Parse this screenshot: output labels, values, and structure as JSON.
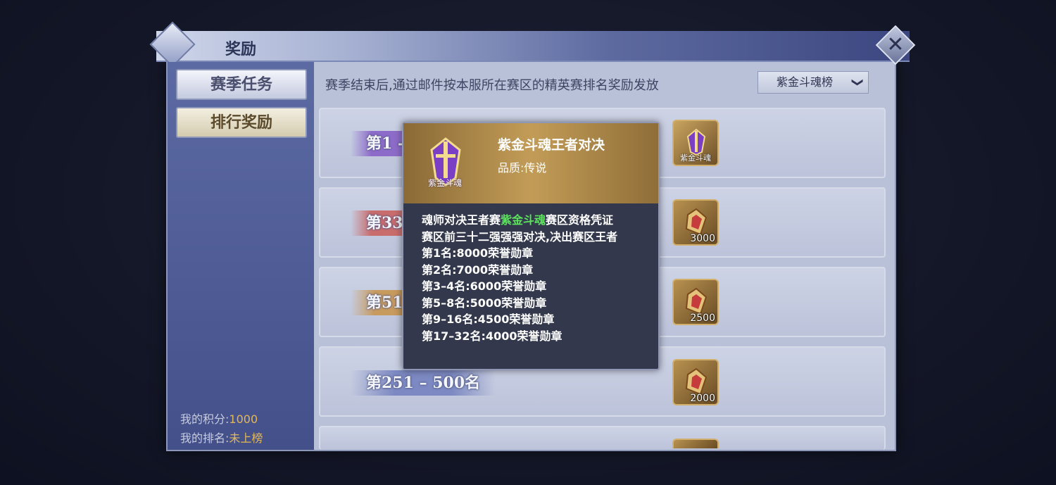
{
  "window": {
    "title": "奖励",
    "close_label": "✕"
  },
  "sidebar": {
    "tabs": [
      {
        "label": "赛季任务"
      },
      {
        "label": "排行奖励"
      }
    ],
    "my_score_label": "我的积分:",
    "my_score_value": "1000",
    "my_rank_label": "我的排名:",
    "my_rank_value": "未上榜"
  },
  "main": {
    "description": "赛季结束后,通过邮件按本服所在赛区的精英赛排名奖励发放",
    "dropdown": {
      "selected": "紫金斗魂榜",
      "arrow": "❯"
    },
    "rows": [
      {
        "rank_label": "第1 -",
        "reward_caption": "紫金斗魂",
        "reward_count": ""
      },
      {
        "rank_label": "第33",
        "reward_caption": "",
        "reward_count": "3000"
      },
      {
        "rank_label": "第51 -",
        "reward_caption": "",
        "reward_count": "2500"
      },
      {
        "rank_label": "第251 – 500名",
        "reward_caption": "",
        "reward_count": "2000"
      }
    ]
  },
  "tooltip": {
    "name": "紫金斗魂王者对决",
    "quality": "品质:传说",
    "icon_caption": "紫金斗魂",
    "desc_prefix": "魂师对决王者赛",
    "desc_highlight": "紫金斗魂",
    "desc_suffix": "赛区资格凭证",
    "desc_line2": "赛区前三十二强强强对决,决出赛区王者",
    "rewards": [
      "第1名:8000荣誉勋章",
      "第2名:7000荣誉勋章",
      "第3–4名:6000荣誉勋章",
      "第5–8名:5000荣誉勋章",
      "第9–16名:4500荣誉勋章",
      "第17–32名:4000荣誉勋章"
    ]
  },
  "colors": {
    "highlight": "#5be35b",
    "gold": "#e2b75a",
    "panel": "#b9c1d8",
    "sidebar": "#4f5c96"
  }
}
